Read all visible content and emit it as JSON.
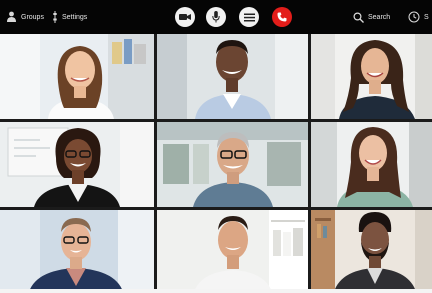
{
  "toolbar": {
    "groups_label": "Groups",
    "settings_label": "Settings",
    "search_label": "Search",
    "more_label": "S"
  },
  "controls": {
    "video_icon": "video-camera-icon",
    "mic_icon": "microphone-icon",
    "chat_icon": "chat-menu-icon",
    "end_icon": "end-call-icon",
    "end_color": "#e31d1a"
  },
  "participants": [
    {
      "tile": "top-left"
    },
    {
      "tile": "top-center"
    },
    {
      "tile": "top-right"
    },
    {
      "tile": "middle-left"
    },
    {
      "tile": "middle-center"
    },
    {
      "tile": "middle-right"
    },
    {
      "tile": "bottom-left"
    },
    {
      "tile": "bottom-center"
    },
    {
      "tile": "bottom-right"
    }
  ]
}
